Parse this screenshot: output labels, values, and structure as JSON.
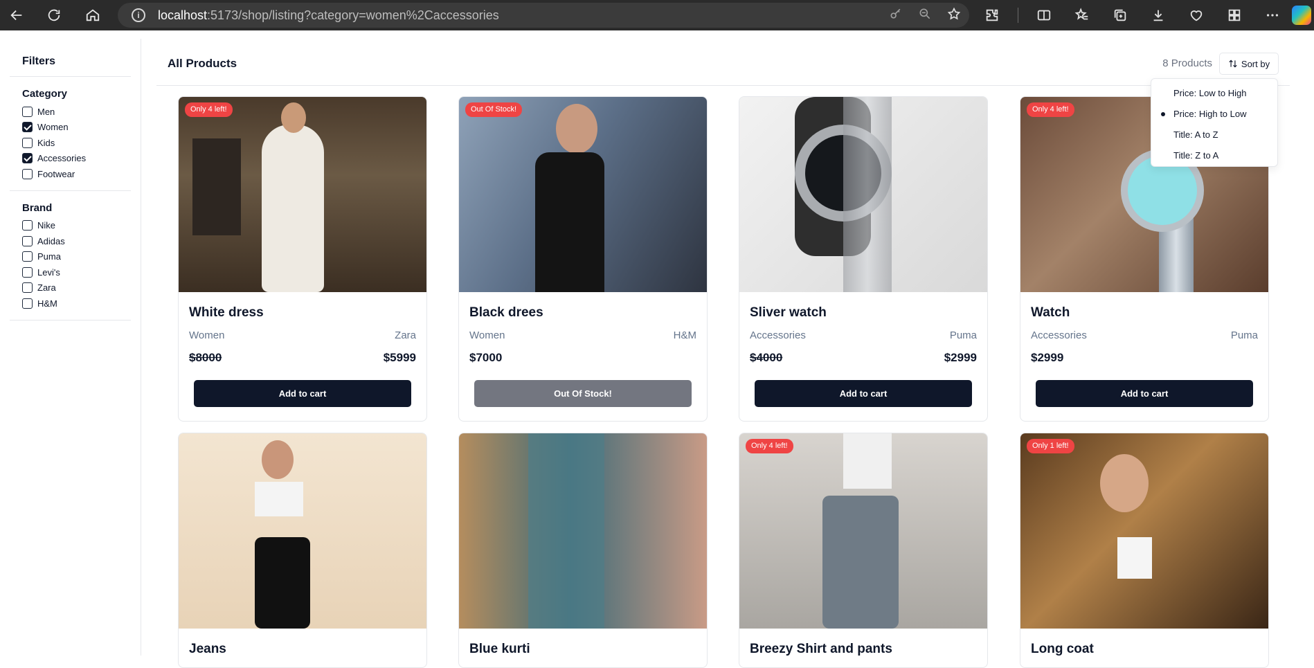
{
  "browser": {
    "url_host": "localhost",
    "url_path": ":5173/shop/listing?category=women%2Caccessories"
  },
  "sidebar": {
    "title": "Filters",
    "groups": [
      {
        "title": "Category",
        "options": [
          {
            "label": "Men",
            "checked": false
          },
          {
            "label": "Women",
            "checked": true
          },
          {
            "label": "Kids",
            "checked": false
          },
          {
            "label": "Accessories",
            "checked": true
          },
          {
            "label": "Footwear",
            "checked": false
          }
        ]
      },
      {
        "title": "Brand",
        "options": [
          {
            "label": "Nike",
            "checked": false
          },
          {
            "label": "Adidas",
            "checked": false
          },
          {
            "label": "Puma",
            "checked": false
          },
          {
            "label": "Levi's",
            "checked": false
          },
          {
            "label": "Zara",
            "checked": false
          },
          {
            "label": "H&M",
            "checked": false
          }
        ]
      }
    ]
  },
  "header": {
    "title": "All Products",
    "count": "8 Products",
    "sort_label": "Sort by"
  },
  "sort_menu": {
    "items": [
      {
        "label": "Price: Low to High",
        "selected": false
      },
      {
        "label": "Price: High to Low",
        "selected": true
      },
      {
        "label": "Title: A to Z",
        "selected": false
      },
      {
        "label": "Title: Z to A",
        "selected": false
      }
    ]
  },
  "products": [
    {
      "badge": "Only 4 left!",
      "name": "White dress",
      "category": "Women",
      "brand": "Zara",
      "price": "$8000",
      "sale_price": "$5999",
      "button": "Add to cart",
      "in_stock": true
    },
    {
      "badge": "Out Of Stock!",
      "name": "Black drees",
      "category": "Women",
      "brand": "H&M",
      "price": "$7000",
      "sale_price": "",
      "button": "Out Of Stock!",
      "in_stock": false
    },
    {
      "badge": "",
      "name": "Sliver watch",
      "category": "Accessories",
      "brand": "Puma",
      "price": "$4000",
      "sale_price": "$2999",
      "button": "Add to cart",
      "in_stock": true
    },
    {
      "badge": "Only 4 left!",
      "name": "Watch",
      "category": "Accessories",
      "brand": "Puma",
      "price": "$2999",
      "sale_price": "",
      "button": "Add to cart",
      "in_stock": true
    },
    {
      "badge": "",
      "name": "Jeans"
    },
    {
      "badge": "",
      "name": "Blue kurti"
    },
    {
      "badge": "Only 4 left!",
      "name": "Breezy Shirt and pants"
    },
    {
      "badge": "Only 1 left!",
      "name": "Long coat"
    }
  ],
  "colors": {
    "primary": "#0f172a",
    "badge": "#ef4444",
    "disabled": "#737680",
    "muted_text": "#64748b"
  }
}
